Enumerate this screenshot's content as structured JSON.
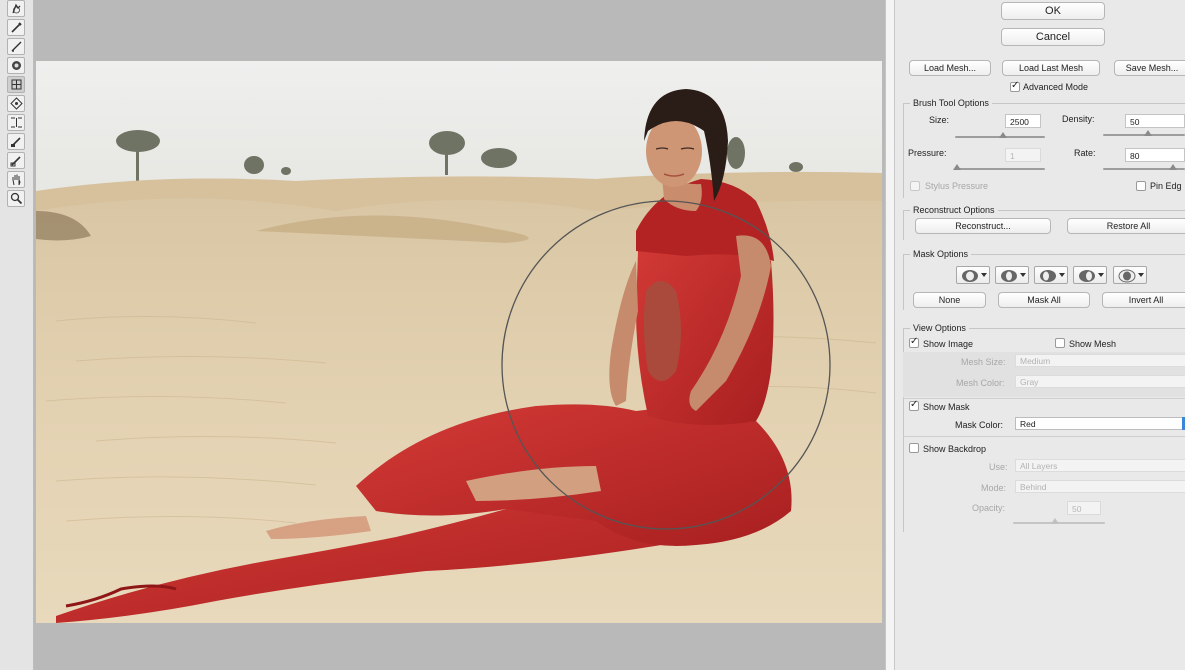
{
  "toolbar": {
    "tools": [
      {
        "name": "forward-warp-tool-icon"
      },
      {
        "name": "reconstruct-tool-icon"
      },
      {
        "name": "smooth-tool-icon"
      },
      {
        "name": "twirl-clockwise-tool-icon"
      },
      {
        "name": "pucker-tool-icon"
      },
      {
        "name": "bloat-tool-icon"
      },
      {
        "name": "push-left-tool-icon"
      },
      {
        "name": "freeze-mask-tool-icon"
      },
      {
        "name": "thaw-mask-tool-icon"
      },
      {
        "name": "hand-tool-icon"
      },
      {
        "name": "zoom-tool-icon"
      }
    ]
  },
  "canvas": {
    "image_subject": "woman in red dress sitting in desert",
    "brush_cursor": true
  },
  "dialog": {
    "ok_label": "OK",
    "cancel_label": "Cancel",
    "load_mesh_label": "Load Mesh...",
    "load_last_mesh_label": "Load Last Mesh",
    "save_mesh_label": "Save Mesh...",
    "advanced_mode_label": "Advanced Mode",
    "advanced_mode_checked": true
  },
  "brush_tool_options": {
    "title": "Brush Tool Options",
    "size_label": "Size:",
    "size_value": "2500",
    "density_label": "Density:",
    "density_value": "50",
    "pressure_label": "Pressure:",
    "pressure_value": "1",
    "rate_label": "Rate:",
    "rate_value": "80",
    "stylus_pressure_label": "Stylus Pressure",
    "pin_edges_label": "Pin Edg"
  },
  "reconstruct_options": {
    "title": "Reconstruct Options",
    "reconstruct_label": "Reconstruct...",
    "restore_all_label": "Restore All"
  },
  "mask_options": {
    "title": "Mask Options",
    "none_label": "None",
    "mask_all_label": "Mask All",
    "invert_all_label": "Invert All"
  },
  "view_options": {
    "title": "View Options",
    "show_image_label": "Show Image",
    "show_image_checked": true,
    "show_mesh_label": "Show Mesh",
    "show_mesh_checked": false,
    "mesh_size_label": "Mesh Size:",
    "mesh_size_value": "Medium",
    "mesh_color_label": "Mesh Color:",
    "mesh_color_value": "Gray",
    "show_mask_label": "Show Mask",
    "show_mask_checked": true,
    "mask_color_label": "Mask Color:",
    "mask_color_value": "Red",
    "show_backdrop_label": "Show Backdrop",
    "show_backdrop_checked": false,
    "use_label": "Use:",
    "use_value": "All Layers",
    "mode_label": "Mode:",
    "mode_value": "Behind",
    "opacity_label": "Opacity:",
    "opacity_value": "50"
  },
  "colors": {
    "dress": "#c62a2a",
    "sand": "#dcc7a3",
    "sky": "#ebebe9",
    "accent": "#3a86d8"
  }
}
